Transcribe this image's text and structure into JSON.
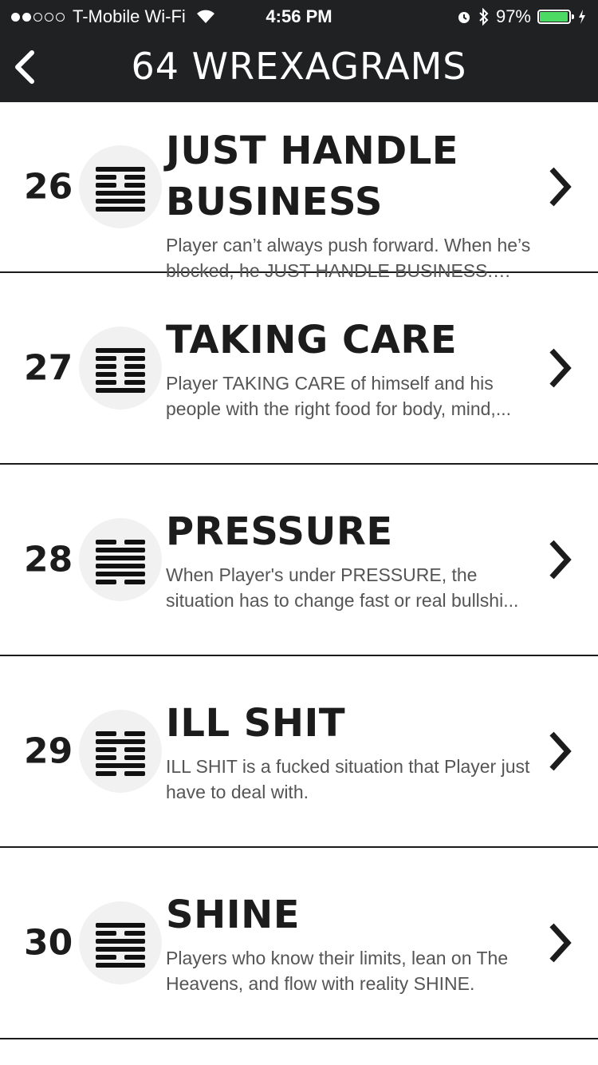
{
  "status_bar": {
    "carrier": "T-Mobile Wi-Fi",
    "time": "4:56 PM",
    "battery": "97%",
    "battery_level": 0.97
  },
  "nav": {
    "title": "64 WREXAGRAMS",
    "back_icon": "chevron-left-icon"
  },
  "items": [
    {
      "number": "26",
      "title": "JUST HANDLE BUSINESS",
      "description": "Player can’t always push forward. When he’s blocked, he JUST HANDLE BUSINESS. Main..."
    },
    {
      "number": "27",
      "title": "TAKING CARE",
      "description": "Player TAKING CARE of himself and his people with the right food for body, mind,..."
    },
    {
      "number": "28",
      "title": "PRESSURE",
      "description": "When Player's under PRESSURE, the situation has to change fast or real bullshi..."
    },
    {
      "number": "29",
      "title": "ILL SHIT",
      "description": "ILL SHIT is a fucked situation that Player just have to deal with."
    },
    {
      "number": "30",
      "title": "SHINE",
      "description": "Players who know their limits, lean on The Heavens, and flow with reality SHINE."
    }
  ]
}
